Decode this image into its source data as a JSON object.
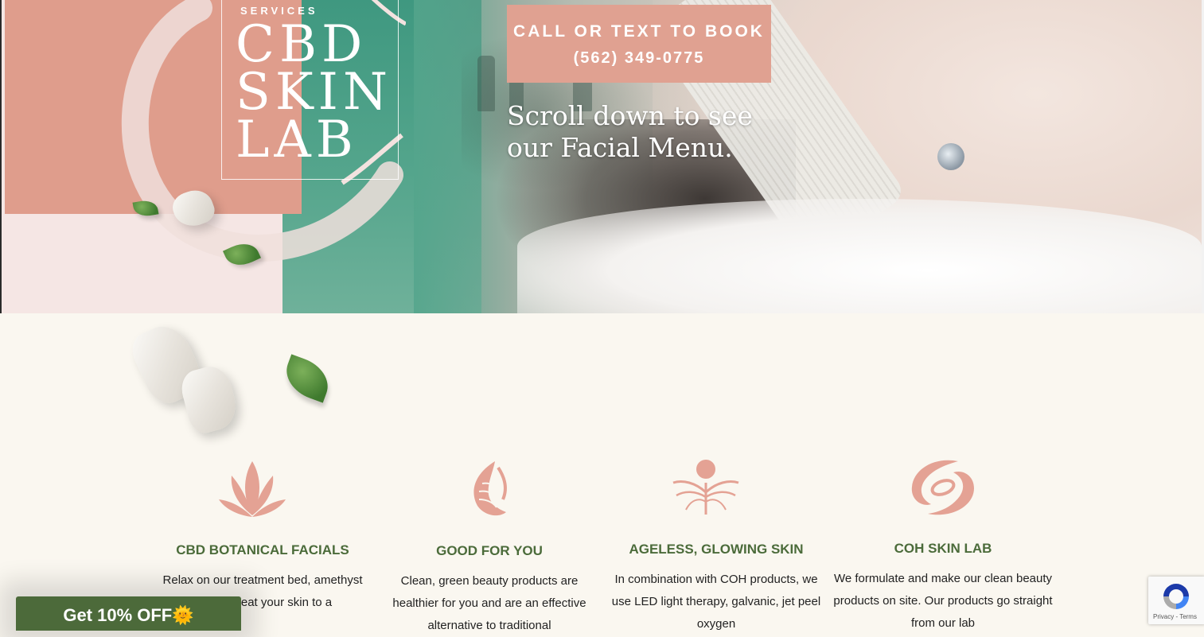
{
  "logo": {
    "services": "SERVICES",
    "line1": "CBD",
    "line2": "SKIN",
    "line3": "LAB"
  },
  "booking": {
    "line1": "CALL OR TEXT TO BOOK",
    "line2": "(562) 349-0775"
  },
  "hero": {
    "scroll_line1": "Scroll down to see",
    "scroll_line2": "our Facial Menu."
  },
  "features": [
    {
      "icon": "lotus-icon",
      "title": "CBD BOTANICAL FACIALS",
      "text": "Relax on our treatment bed, amethyst crystals reat your skin to a"
    },
    {
      "icon": "wave-shell-icon",
      "title": "GOOD FOR YOU",
      "text": "Clean, green beauty products are healthier for you and are an effective alternative to traditional"
    },
    {
      "icon": "radiant-figure-icon",
      "title": "AGELESS, GLOWING SKIN",
      "text": "In combination with COH products, we use LED light therapy, galvanic, jet peel oxygen"
    },
    {
      "icon": "orbit-swirl-icon",
      "title": "COH SKIN LAB",
      "text": "We formulate and make our clean beauty products on site. Our products go straight from our lab"
    }
  ],
  "promo": {
    "label": "Get 10% OFF",
    "emoji": "🌞"
  },
  "recaptcha": {
    "text": "Privacy - Terms"
  },
  "colors": {
    "accent_pink": "#df9d8c",
    "booking_pink": "#e0a191",
    "teal": "#54a58c",
    "heading_green": "#4b6b3a",
    "promo_green": "#4c6a3a",
    "page_bg": "#faf7f0"
  }
}
